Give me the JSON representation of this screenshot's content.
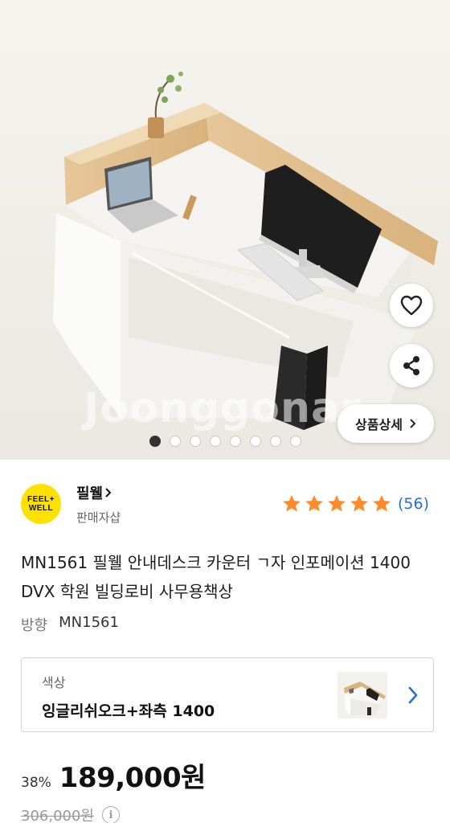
{
  "hero": {
    "watermark": "Joonggonar",
    "detail_button": "상품상세",
    "slide_count": 8,
    "active_slide": 1
  },
  "seller": {
    "logo_line1": "FEEL+",
    "logo_line2": "WELL",
    "name": "필웰",
    "subtitle": "판매자샵",
    "rating_stars": 5,
    "review_count": "(56)"
  },
  "product": {
    "title": "MN1561 필웰 안내데스크 카운터 ㄱ자 인포메이션 1400 DVX 학원 빌딩로비 사무용책상",
    "option_label": "방향",
    "option_value": "MN1561"
  },
  "color_selector": {
    "label": "색상",
    "value": "잉글리쉬오크+좌측 1400"
  },
  "price": {
    "discount": "38%",
    "sale_price": "189,000원",
    "original_price": "306,000원"
  },
  "colors": {
    "accent": "#2b6dd8",
    "star": "#ff8a2b",
    "logo_yellow": "#ffe100"
  }
}
